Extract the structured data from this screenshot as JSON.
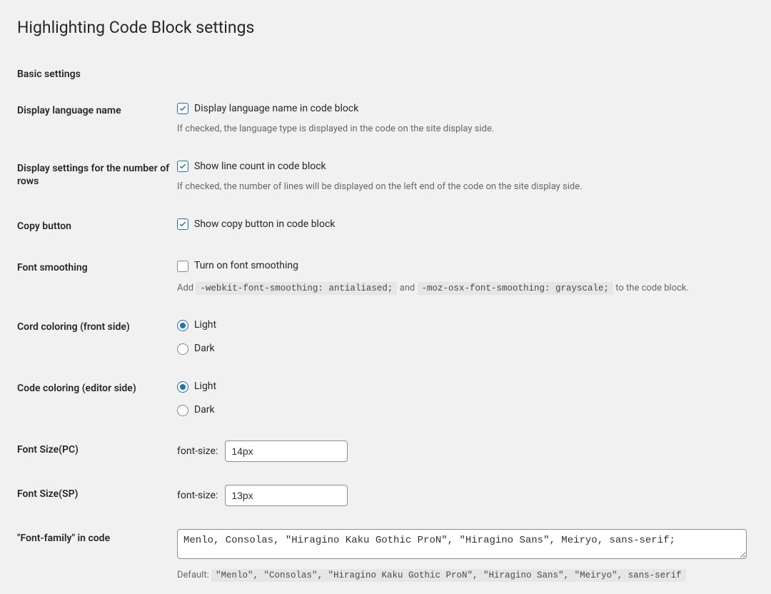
{
  "page": {
    "title": "Highlighting Code Block settings",
    "section": "Basic settings"
  },
  "rows": {
    "display_lang": {
      "th": "Display language name",
      "checkbox_label": "Display language name in code block",
      "checked": true,
      "desc": "If checked, the language type is displayed in the code on the site display side."
    },
    "line_count": {
      "th": "Display settings for the number of rows",
      "checkbox_label": "Show line count in code block",
      "checked": true,
      "desc": "If checked, the number of lines will be displayed on the left end of the code on the site display side."
    },
    "copy_button": {
      "th": "Copy button",
      "checkbox_label": "Show copy button in code block",
      "checked": true
    },
    "font_smoothing": {
      "th": "Font smoothing",
      "checkbox_label": "Turn on font smoothing",
      "checked": false,
      "desc_prefix": "Add",
      "code1": "-webkit-font-smoothing: antialiased;",
      "desc_mid": "and",
      "code2": "-moz-osx-font-smoothing: grayscale;",
      "desc_suffix": "to the code block."
    },
    "front_coloring": {
      "th": "Cord coloring (front side)",
      "options": {
        "light": "Light",
        "dark": "Dark"
      },
      "selected": "light"
    },
    "editor_coloring": {
      "th": "Code coloring (editor side)",
      "options": {
        "light": "Light",
        "dark": "Dark"
      },
      "selected": "light"
    },
    "font_size_pc": {
      "th": "Font Size(PC)",
      "prefix": "font-size:",
      "value": "14px"
    },
    "font_size_sp": {
      "th": "Font Size(SP)",
      "prefix": "font-size:",
      "value": "13px"
    },
    "font_family": {
      "th": "\"Font-family\" in code",
      "value": "Menlo, Consolas, \"Hiragino Kaku Gothic ProN\", \"Hiragino Sans\", Meiryo, sans-serif;",
      "default_label": "Default:",
      "default_code": "\"Menlo\", \"Consolas\", \"Hiragino Kaku Gothic ProN\", \"Hiragino Sans\", \"Meiryo\", sans-serif"
    }
  }
}
